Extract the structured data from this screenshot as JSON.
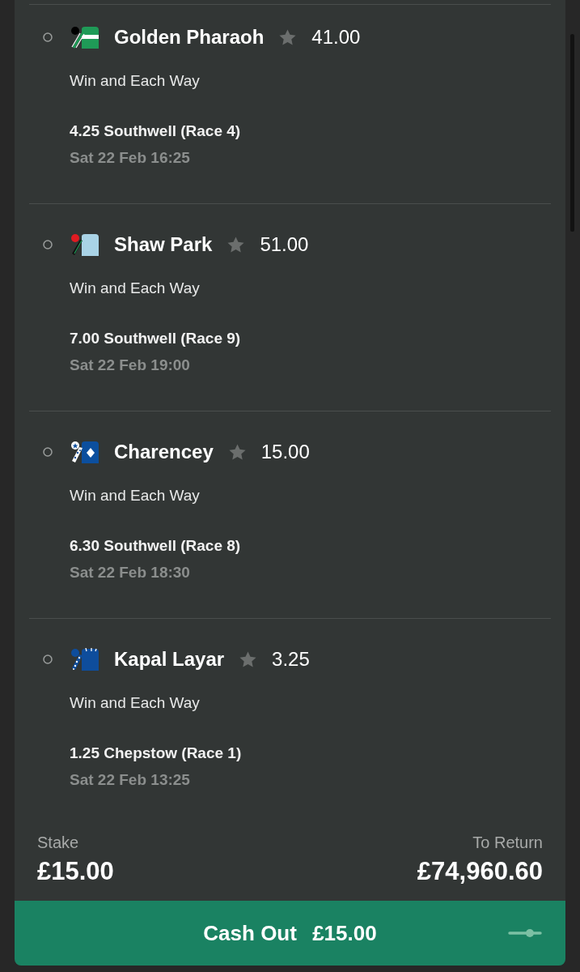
{
  "selections": [
    {
      "name": "Golden Pharaoh",
      "odds": "41.00",
      "silk": {
        "kind": "hoop",
        "color": "#1f9a57"
      },
      "bet_type": "Win and Each Way",
      "race": "4.25 Southwell (Race 4)",
      "date": "Sat 22 Feb 16:25"
    },
    {
      "name": "Shaw Park",
      "odds": "51.00",
      "silk": {
        "kind": "plain",
        "color": "#a9d3e6"
      },
      "bet_type": "Win and Each Way",
      "race": "7.00 Southwell (Race 9)",
      "date": "Sat 22 Feb 19:00"
    },
    {
      "name": "Charencey",
      "odds": "15.00",
      "silk": {
        "kind": "diamond",
        "color": "#0c4f9e"
      },
      "bet_type": "Win and Each Way",
      "race": "6.30 Southwell (Race 8)",
      "date": "Sat 22 Feb 18:30"
    },
    {
      "name": "Kapal Layar",
      "odds": "3.25",
      "silk": {
        "kind": "spots",
        "color": "#0e4d9c"
      },
      "bet_type": "Win and Each Way",
      "race": "1.25 Chepstow (Race 1)",
      "date": "Sat 22 Feb 13:25"
    }
  ],
  "stake": {
    "label": "Stake",
    "value": "£15.00"
  },
  "to_return": {
    "label": "To Return",
    "value": "£74,960.60"
  },
  "cash_out": {
    "label": "Cash Out",
    "amount": "£15.00"
  }
}
